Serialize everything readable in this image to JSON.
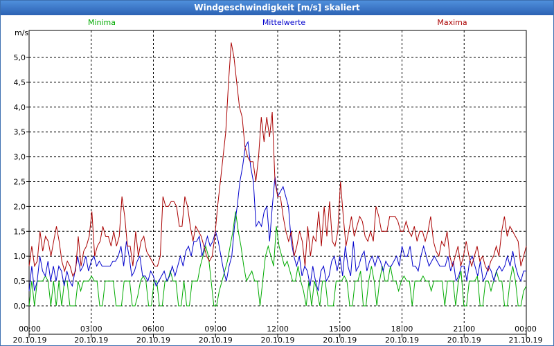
{
  "window": {
    "title": "Windgeschwindigkeit [m/s] skaliert"
  },
  "chart_data": {
    "type": "line",
    "title": "Windgeschwindigkeit [m/s] skaliert",
    "ylabel": "m/s",
    "ylim": [
      0,
      5.5
    ],
    "xlim": [
      0,
      24
    ],
    "grid": true,
    "legend_position": "top",
    "x_ticks": [
      {
        "time": "00:00",
        "date": "20.10.19"
      },
      {
        "time": "03:00",
        "date": "20.10.19"
      },
      {
        "time": "06:00",
        "date": "20.10.19"
      },
      {
        "time": "09:00",
        "date": "20.10.19"
      },
      {
        "time": "12:00",
        "date": "20.10.19"
      },
      {
        "time": "15:00",
        "date": "20.10.19"
      },
      {
        "time": "18:00",
        "date": "20.10.19"
      },
      {
        "time": "21:00",
        "date": "20.10.19"
      },
      {
        "time": "00:00",
        "date": "21.10.19"
      }
    ],
    "y_ticks": [
      "0,0",
      "0,5",
      "1,0",
      "1,5",
      "2,0",
      "2,5",
      "3,0",
      "3,5",
      "4,0",
      "4,5",
      "5,0"
    ],
    "series": [
      {
        "name": "Minima",
        "color": "#00aa00",
        "values": [
          0.0,
          0.5,
          0.0,
          0.5,
          0.5,
          0.5,
          0.6,
          0.5,
          0.0,
          0.5,
          0.0,
          0.5,
          0.0,
          0.5,
          0.5,
          0.0,
          0.0,
          0.0,
          0.5,
          0.3,
          0.5,
          0.5,
          0.5,
          0.6,
          0.5,
          0.5,
          0.0,
          0.0,
          0.5,
          0.5,
          0.5,
          0.5,
          0.0,
          0.0,
          0.0,
          0.5,
          0.5,
          0.5,
          0.0,
          0.0,
          0.2,
          0.5,
          0.6,
          0.5,
          0.0,
          0.0,
          0.5,
          0.5,
          0.0,
          0.0,
          0.5,
          0.5,
          0.7,
          0.5,
          0.5,
          0.0,
          0.0,
          0.5,
          0.0,
          0.0,
          0.5,
          0.5,
          0.5,
          0.8,
          1.0,
          1.2,
          1.0,
          0.5,
          0.0,
          0.0,
          0.3,
          0.5,
          0.7,
          0.9,
          1.2,
          1.5,
          1.9,
          1.5,
          1.2,
          0.8,
          0.5,
          0.6,
          0.7,
          0.5,
          0.5,
          0.0,
          0.5,
          1.0,
          1.2,
          1.0,
          0.8,
          1.6,
          1.2,
          1.0,
          0.8,
          0.9,
          0.7,
          0.5,
          0.5,
          0.8,
          0.5,
          0.3,
          0.0,
          0.5,
          0.0,
          0.5,
          0.3,
          0.0,
          0.5,
          0.5,
          0.0,
          0.0,
          0.0,
          0.5,
          0.5,
          0.5,
          0.6,
          0.5,
          0.0,
          0.0,
          0.5,
          0.5,
          0.7,
          0.0,
          0.0,
          0.5,
          0.8,
          0.5,
          0.0,
          0.5,
          0.8,
          0.5,
          0.5,
          0.8,
          0.5,
          0.5,
          0.3,
          0.5,
          0.6,
          0.5,
          0.5,
          0.0,
          0.5,
          0.5,
          0.5,
          0.6,
          0.5,
          0.5,
          0.3,
          0.5,
          0.5,
          0.5,
          0.5,
          0.0,
          0.5,
          0.5,
          0.5,
          0.0,
          0.5,
          0.7,
          0.0,
          0.0,
          0.5,
          0.5,
          0.5,
          0.6,
          0.0,
          0.0,
          0.5,
          0.5,
          0.3,
          0.5,
          0.7,
          0.5,
          0.5,
          0.0,
          0.0,
          0.5,
          0.8,
          0.5,
          0.0,
          0.0,
          0.3,
          0.4
        ]
      },
      {
        "name": "Mittelwerte",
        "color": "#0000cc",
        "values": [
          0.3,
          0.8,
          0.3,
          0.5,
          1.0,
          0.7,
          0.6,
          0.9,
          0.5,
          0.8,
          0.5,
          0.8,
          0.7,
          0.4,
          0.7,
          0.5,
          0.4,
          0.7,
          1.0,
          0.7,
          0.8,
          1.0,
          0.7,
          0.9,
          1.0,
          0.8,
          0.9,
          0.8,
          0.8,
          0.8,
          0.8,
          0.9,
          0.9,
          1.0,
          1.2,
          0.8,
          1.3,
          1.0,
          0.6,
          0.7,
          0.9,
          1.0,
          0.6,
          0.6,
          0.5,
          0.7,
          0.6,
          0.4,
          0.5,
          0.6,
          0.7,
          0.5,
          0.6,
          0.8,
          0.6,
          0.8,
          1.0,
          0.8,
          1.1,
          1.2,
          1.0,
          1.3,
          1.3,
          1.4,
          1.0,
          1.2,
          1.4,
          1.2,
          1.3,
          1.5,
          1.3,
          1.0,
          0.7,
          0.5,
          0.8,
          1.0,
          1.6,
          2.0,
          2.5,
          2.8,
          3.2,
          3.3,
          2.8,
          2.5,
          1.6,
          1.7,
          1.6,
          1.9,
          2.0,
          1.3,
          2.0,
          2.6,
          2.2,
          2.3,
          2.4,
          2.2,
          2.0,
          1.3,
          1.0,
          0.8,
          1.0,
          0.6,
          0.8,
          0.7,
          0.4,
          0.8,
          0.5,
          0.3,
          0.7,
          0.8,
          0.5,
          0.6,
          0.9,
          1.0,
          0.7,
          1.0,
          0.6,
          1.2,
          0.8,
          0.6,
          1.3,
          0.7,
          0.8,
          1.0,
          1.1,
          0.7,
          0.9,
          1.0,
          0.8,
          1.0,
          0.9,
          0.7,
          0.9,
          0.8,
          0.8,
          0.9,
          1.0,
          0.8,
          1.2,
          1.0,
          1.0,
          1.2,
          0.8,
          0.8,
          0.7,
          1.0,
          1.2,
          1.0,
          0.8,
          0.9,
          1.0,
          0.9,
          0.8,
          0.8,
          0.8,
          1.0,
          0.7,
          0.9,
          0.5,
          0.6,
          0.8,
          0.8,
          0.5,
          0.9,
          1.0,
          0.8,
          0.6,
          0.9,
          0.5,
          0.6,
          0.8,
          0.7,
          0.5,
          0.7,
          0.8,
          0.7,
          0.8,
          1.0,
          0.8,
          1.1,
          0.8,
          0.6,
          0.5,
          0.7,
          0.7
        ]
      },
      {
        "name": "Maxima",
        "color": "#aa0000",
        "values": [
          0.8,
          1.2,
          0.8,
          0.9,
          1.5,
          1.1,
          1.4,
          1.3,
          1.0,
          1.3,
          1.6,
          1.3,
          0.9,
          0.7,
          0.9,
          0.8,
          0.6,
          0.7,
          1.4,
          0.8,
          1.1,
          1.2,
          1.4,
          1.9,
          1.0,
          1.2,
          1.3,
          1.6,
          1.4,
          1.4,
          1.2,
          1.5,
          1.2,
          1.4,
          2.2,
          1.8,
          1.2,
          1.2,
          0.8,
          1.5,
          1.0,
          1.3,
          1.4,
          1.1,
          1.0,
          0.9,
          0.8,
          0.8,
          1.0,
          2.2,
          2.0,
          2.0,
          2.1,
          2.1,
          2.0,
          1.6,
          1.6,
          2.2,
          2.0,
          1.6,
          1.3,
          1.6,
          1.5,
          1.4,
          1.2,
          1.0,
          0.9,
          1.0,
          1.4,
          2.0,
          2.5,
          3.0,
          3.5,
          4.5,
          5.3,
          5.0,
          4.5,
          4.0,
          3.8,
          3.2,
          3.0,
          2.9,
          2.9,
          2.5,
          3.0,
          3.8,
          3.3,
          3.8,
          3.4,
          3.9,
          2.5,
          2.2,
          2.2,
          1.8,
          1.5,
          1.3,
          1.5,
          1.0,
          1.2,
          1.5,
          1.3,
          0.8,
          1.6,
          1.0,
          1.4,
          1.3,
          1.9,
          1.2,
          2.0,
          1.4,
          2.1,
          1.3,
          1.2,
          1.5,
          2.5,
          1.8,
          1.2,
          1.5,
          1.8,
          1.4,
          1.6,
          1.8,
          1.7,
          1.4,
          1.3,
          1.5,
          1.3,
          2.0,
          1.8,
          1.5,
          1.5,
          1.5,
          1.8,
          1.8,
          1.8,
          1.7,
          1.5,
          1.5,
          1.7,
          1.5,
          1.4,
          1.6,
          1.3,
          1.5,
          1.5,
          1.3,
          1.5,
          1.8,
          1.3,
          1.1,
          1.0,
          1.3,
          1.2,
          1.5,
          1.0,
          0.8,
          1.0,
          1.2,
          0.8,
          1.0,
          1.3,
          1.0,
          0.8,
          1.0,
          1.2,
          0.9,
          1.0,
          0.8,
          0.7,
          0.9,
          1.0,
          1.2,
          1.0,
          1.5,
          1.8,
          1.4,
          1.6,
          1.5,
          1.4,
          1.3,
          0.8,
          1.0,
          1.2
        ]
      }
    ]
  }
}
